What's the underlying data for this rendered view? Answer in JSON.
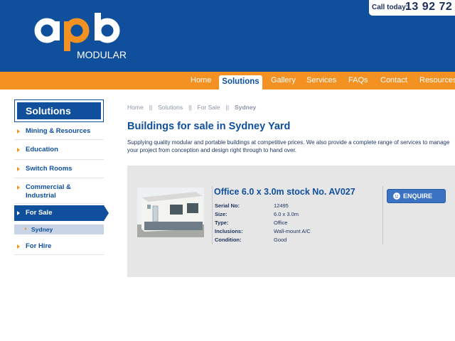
{
  "brand": {
    "logo_text": "apb",
    "logo_sub": "MODULAR"
  },
  "call": {
    "label": "Call today:",
    "number": "13 92 72"
  },
  "nav": {
    "items": [
      {
        "label": "Home"
      },
      {
        "label": "Solutions"
      },
      {
        "label": "Gallery"
      },
      {
        "label": "Services"
      },
      {
        "label": "FAQs"
      },
      {
        "label": "Contact"
      },
      {
        "label": "Resources"
      }
    ],
    "active": "Solutions"
  },
  "sidebar": {
    "heading": "Solutions",
    "items": [
      {
        "label": "Mining & Resources"
      },
      {
        "label": "Education"
      },
      {
        "label": "Switch Rooms"
      },
      {
        "label": "Commercial & Industrial"
      },
      {
        "label": "For Sale"
      },
      {
        "label": "For Hire"
      }
    ],
    "sub_items": [
      {
        "label": "Sydney"
      }
    ]
  },
  "breadcrumb": {
    "items": [
      "Home",
      "Solutions",
      "For Sale",
      "Sydney"
    ],
    "separator": "||"
  },
  "page": {
    "title": "Buildings for sale in Sydney Yard",
    "intro": "Supplying quality modular and portable buildings at competitive prices. We also provide a complete range of services to manage your project from conception and design right through to hand over."
  },
  "listing": {
    "title": "Office 6.0 x 3.0m stock No. AV027",
    "specs": [
      {
        "key": "Serial No:",
        "value": "12495"
      },
      {
        "key": "Size:",
        "value": "6.0 x 3.0m"
      },
      {
        "key": "Type:",
        "value": "Office"
      },
      {
        "key": "Inclusions:",
        "value": "Wall-mount A/C"
      },
      {
        "key": "Condition:",
        "value": "Good"
      }
    ],
    "enquire_label": "ENQUIRE"
  },
  "colors": {
    "brand_blue": "#0f4f9c",
    "brand_orange": "#f39223"
  }
}
